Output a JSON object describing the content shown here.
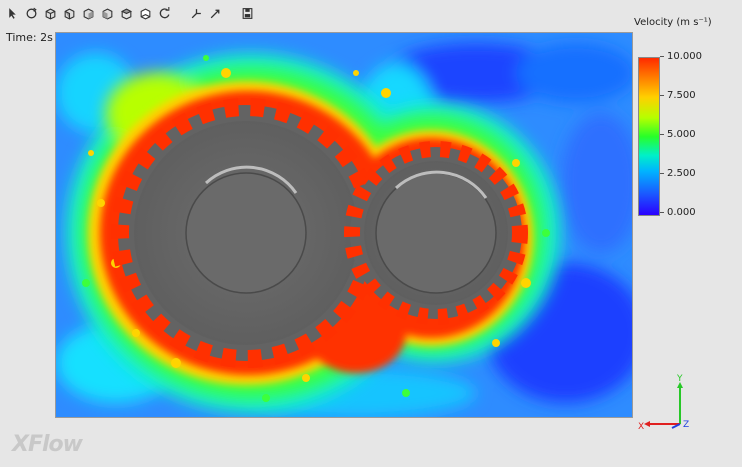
{
  "toolbar": {
    "icons": [
      "select-icon",
      "rotate-icon",
      "view-front-icon",
      "view-back-icon",
      "view-left-icon",
      "view-right-icon",
      "view-top-icon",
      "view-bottom-icon",
      "reset-view-icon",
      "pan-icon",
      "zoom-icon",
      "save-icon"
    ]
  },
  "time_label": "Time: 2s",
  "legend": {
    "title": "Velocity (m s⁻¹)",
    "ticks": [
      "10.000",
      "7.500",
      "5.000",
      "2.500",
      "0.000"
    ]
  },
  "axes": {
    "x": "X",
    "y": "Y",
    "z": "Z"
  },
  "logo": "XFlow",
  "colors": {
    "high": "#ff2a00",
    "mid": "#28ff28",
    "low": "#2a00ff",
    "gear": "#6b6b6b"
  }
}
